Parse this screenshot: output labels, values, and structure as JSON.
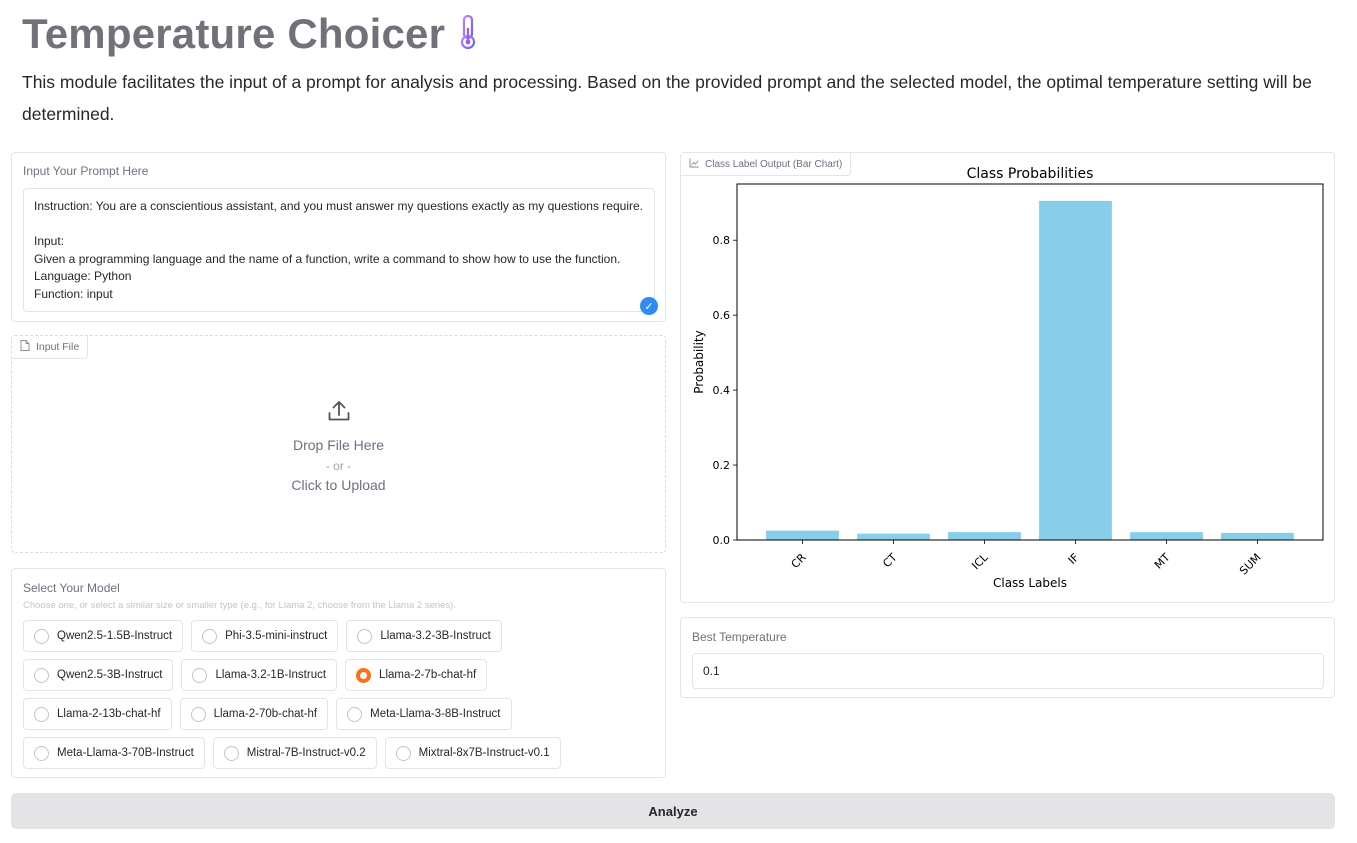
{
  "header": {
    "title": "Temperature Choicer",
    "title_icon": "thermometer-icon",
    "description": "This module facilitates the input of a prompt for analysis and processing. Based on the provided prompt and the selected model, the optimal temperature setting will be determined."
  },
  "prompt": {
    "label": "Input Your Prompt Here",
    "value": "Instruction: You are a conscientious assistant, and you must answer my questions exactly as my questions require.\n\nInput:\nGiven a programming language and the name of a function, write a command to show how to use the function.\nLanguage: Python\nFunction: input",
    "status_icon": "check-circle-icon"
  },
  "file": {
    "label": "Input File",
    "label_icon": "file-icon",
    "upload_icon": "upload-icon",
    "drop_text": "Drop File Here",
    "or_text": "- or -",
    "click_text": "Click to Upload"
  },
  "model": {
    "label": "Select Your Model",
    "hint": "Choose one, or select a similar size or smaller type (e.g., for Llama 2, choose from the Llama 2 series).",
    "selected": "Llama-2-7b-chat-hf",
    "options": [
      "Qwen2.5-1.5B-Instruct",
      "Phi-3.5-mini-instruct",
      "Llama-3.2-3B-Instruct",
      "Qwen2.5-3B-Instruct",
      "Llama-3.2-1B-Instruct",
      "Llama-2-7b-chat-hf",
      "Llama-2-13b-chat-hf",
      "Llama-2-70b-chat-hf",
      "Meta-Llama-3-8B-Instruct",
      "Meta-Llama-3-70B-Instruct",
      "Mistral-7B-Instruct-v0.2",
      "Mixtral-8x7B-Instruct-v0.1"
    ]
  },
  "chart_panel": {
    "label": "Class Label Output (Bar Chart)",
    "label_icon": "chart-icon"
  },
  "chart_data": {
    "type": "bar",
    "title": "Class Probabilities",
    "xlabel": "Class Labels",
    "ylabel": "Probability",
    "categories": [
      "CR",
      "CT",
      "ICL",
      "IF",
      "MT",
      "SUM"
    ],
    "values": [
      0.025,
      0.017,
      0.021,
      0.905,
      0.021,
      0.019
    ],
    "ylim": [
      0,
      0.95
    ],
    "yticks": [
      "0.0",
      "0.2",
      "0.4",
      "0.6",
      "0.8"
    ],
    "bar_color": "#87ceeb",
    "grid": false
  },
  "temperature": {
    "label": "Best Temperature",
    "value": "0.1"
  },
  "actions": {
    "analyze_label": "Analyze"
  },
  "colors": {
    "accent": "#f97316",
    "check": "#2f8cf5",
    "thermometer": "#a855f7"
  }
}
